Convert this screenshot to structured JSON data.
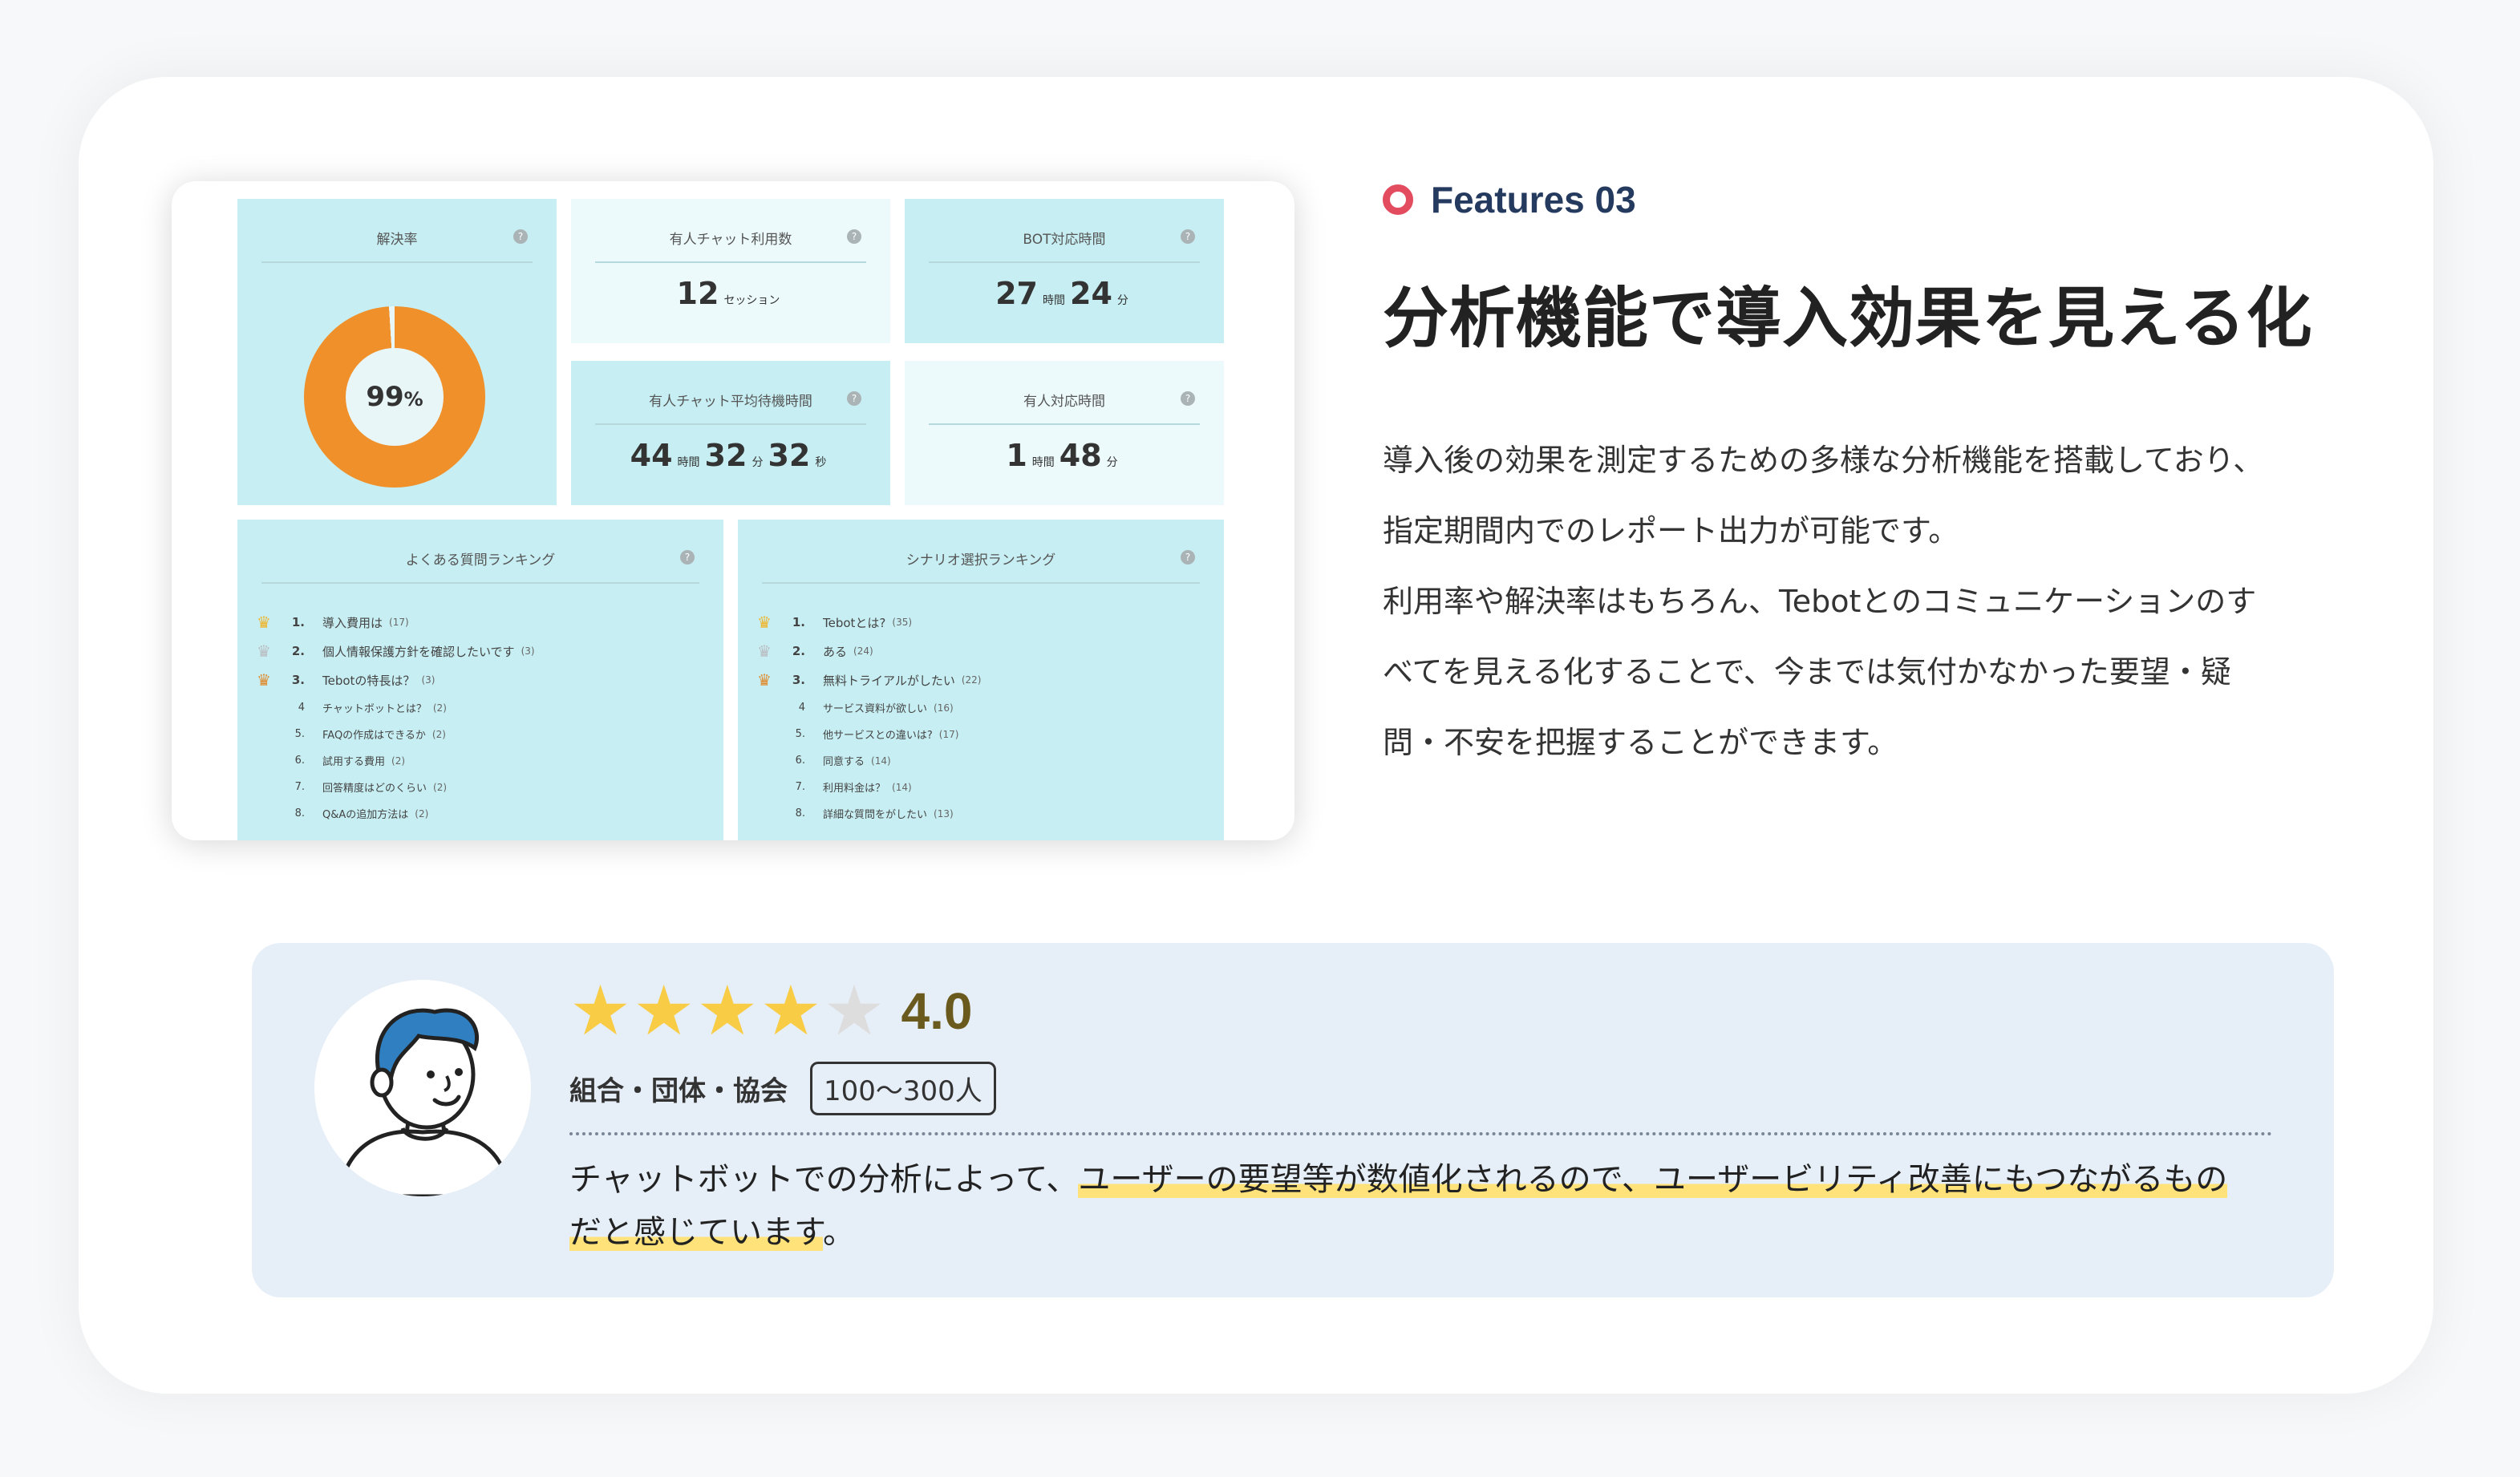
{
  "dashboard": {
    "resolution_rate": {
      "title": "解決率",
      "value": "99",
      "unit": "%"
    },
    "staffed_chat_count": {
      "title": "有人チャット利用数",
      "value": "12",
      "unit": "セッション"
    },
    "bot_time": {
      "title": "BOT対応時間",
      "h": "27",
      "h_unit": "時間",
      "m": "24",
      "m_unit": "分"
    },
    "staffed_avg_wait": {
      "title": "有人チャット平均待機時間",
      "h": "44",
      "h_unit": "時間",
      "m": "32",
      "m_unit": "分",
      "s": "32",
      "s_unit": "秒"
    },
    "staffed_time": {
      "title": "有人対応時間",
      "h": "1",
      "h_unit": "時間",
      "m": "48",
      "m_unit": "分"
    },
    "faq_ranking": {
      "title": "よくある質問ランキング",
      "items": [
        {
          "rank": "1.",
          "label": "導入費用は",
          "count": "(17)"
        },
        {
          "rank": "2.",
          "label": "個人情報保護方針を確認したいです",
          "count": "(3)"
        },
        {
          "rank": "3.",
          "label": "Tebotの特長は？",
          "count": "(3)"
        },
        {
          "rank": "4",
          "label": "チャットボットとは？",
          "count": "(2)"
        },
        {
          "rank": "5.",
          "label": "FAQの作成はできるか",
          "count": "(2)"
        },
        {
          "rank": "6.",
          "label": "試用する費用",
          "count": "(2)"
        },
        {
          "rank": "7.",
          "label": "回答精度はどのくらい",
          "count": "(2)"
        },
        {
          "rank": "8.",
          "label": "Q&Aの追加方法は",
          "count": "(2)"
        }
      ]
    },
    "scenario_ranking": {
      "title": "シナリオ選択ランキング",
      "items": [
        {
          "rank": "1.",
          "label": "Tebotとは?",
          "count": "(35)"
        },
        {
          "rank": "2.",
          "label": "ある",
          "count": "(24)"
        },
        {
          "rank": "3.",
          "label": "無料トライアルがしたい",
          "count": "(22)"
        },
        {
          "rank": "4",
          "label": "サービス資料が欲しい",
          "count": "(16)"
        },
        {
          "rank": "5.",
          "label": "他サービスとの違いは?",
          "count": "(17)"
        },
        {
          "rank": "6.",
          "label": "同意する",
          "count": "(14)"
        },
        {
          "rank": "7.",
          "label": "利用料金は？",
          "count": "(14)"
        },
        {
          "rank": "8.",
          "label": "詳細な質問をがしたい",
          "count": "(13)"
        }
      ]
    },
    "help_glyph": "?"
  },
  "feature": {
    "label": "Features 03",
    "heading": "分析機能で導入効果を見える化",
    "description_lines": [
      "導入後の効果を測定するための多様な分析機能を搭載しており、",
      "指定期間内でのレポート出力が可能です。",
      "利用率や解決率はもちろん、Tebotとのコミュニケーションのす",
      "べてを見える化することで、今までは気付かなかった要望・疑",
      "問・不安を把握することができます。"
    ]
  },
  "review": {
    "rating": 4.0,
    "rating_text": "4.0",
    "stars_max": 5,
    "organization_type": "組合・団体・協会",
    "company_size": "100〜300人",
    "comment_plain": "チャットボットでの分析によって、",
    "comment_highlight_1": "ユーザーの要望等が数値化されるので、ユーザービリティ改善にもつながるもの",
    "comment_highlight_2": "だと感じています",
    "comment_end": "。"
  },
  "colors": {
    "accent_red": "#e34b5f",
    "label_navy": "#243a5e",
    "star_yellow": "#f8cc45",
    "donut_orange": "#f0902a",
    "panel_cyan": "#c7eef2",
    "review_bg": "#e6eef7",
    "highlight": "#ffe27a"
  }
}
